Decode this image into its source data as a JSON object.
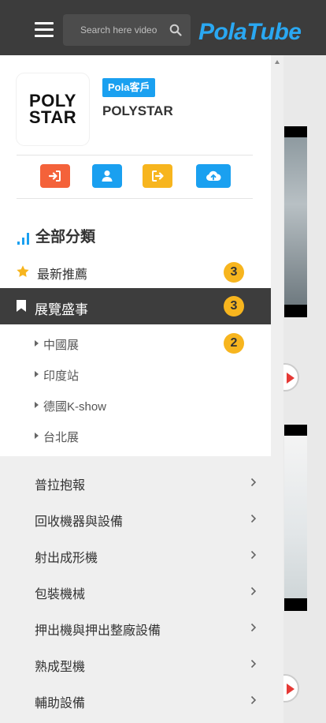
{
  "header": {
    "search_placeholder": "Search here video",
    "logo_text": "PolaTube",
    "icons": [
      "menu-icon",
      "search-icon"
    ]
  },
  "profile": {
    "logo_text_line1": "POLY",
    "logo_text_line2": "STAR",
    "member_badge": "Pola客戶",
    "company_name": "POLYSTAR"
  },
  "actions": [
    {
      "icon": "sign-in-icon",
      "color": "#f4623a"
    },
    {
      "icon": "user-icon",
      "color": "#1aa0f0"
    },
    {
      "icon": "sign-out-icon",
      "color": "#f7b51e"
    },
    {
      "icon": "cloud-upload-icon",
      "color": "#1aa0f0"
    }
  ],
  "categories": {
    "title": "全部分類",
    "featured": {
      "label": "最新推薦",
      "count": "3"
    },
    "active": {
      "label": "展覽盛事",
      "count": "3"
    },
    "sub_items": [
      {
        "label": "中國展",
        "count": "2"
      },
      {
        "label": "印度站"
      },
      {
        "label": "德國K-show"
      },
      {
        "label": "台北展"
      }
    ],
    "items": [
      {
        "label": "普拉抱報"
      },
      {
        "label": "回收機器與設備"
      },
      {
        "label": "射出成形機"
      },
      {
        "label": "包裝機械"
      },
      {
        "label": "押出機與押出整廠設備"
      },
      {
        "label": "熟成型機"
      },
      {
        "label": "輔助設備"
      }
    ]
  },
  "colors": {
    "header_bg": "#3c3c3c",
    "accent_blue": "#1aa0f0",
    "badge_yellow": "#f7b51e",
    "active_row_bg": "#3d3d3d"
  }
}
